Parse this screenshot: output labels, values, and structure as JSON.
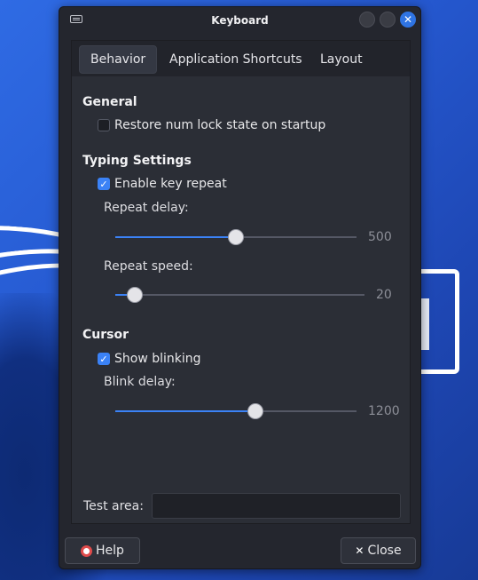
{
  "window": {
    "title": "Keyboard"
  },
  "tabs": [
    {
      "label": "Behavior",
      "active": true
    },
    {
      "label": "Application Shortcuts",
      "active": false
    },
    {
      "label": "Layout",
      "active": false
    }
  ],
  "general": {
    "heading": "General",
    "restore_numlock": {
      "label": "Restore num lock state on startup",
      "checked": false
    }
  },
  "typing": {
    "heading": "Typing Settings",
    "key_repeat": {
      "label": "Enable key repeat",
      "checked": true
    },
    "repeat_delay": {
      "label": "Repeat delay:",
      "value": "500",
      "level": 0.5
    },
    "repeat_speed": {
      "label": "Repeat speed:",
      "value": "20",
      "level": 0.08
    }
  },
  "cursor": {
    "heading": "Cursor",
    "blinking": {
      "label": "Show blinking",
      "checked": true
    },
    "blink_delay": {
      "label": "Blink delay:",
      "value": "1200",
      "level": 0.58
    }
  },
  "test_area": {
    "label": "Test area:",
    "value": ""
  },
  "buttons": {
    "help": "Help",
    "close": "Close"
  },
  "colors": {
    "accent": "#3b82f6",
    "window_bg": "#24262e",
    "desktop": "#2a5fd6"
  }
}
